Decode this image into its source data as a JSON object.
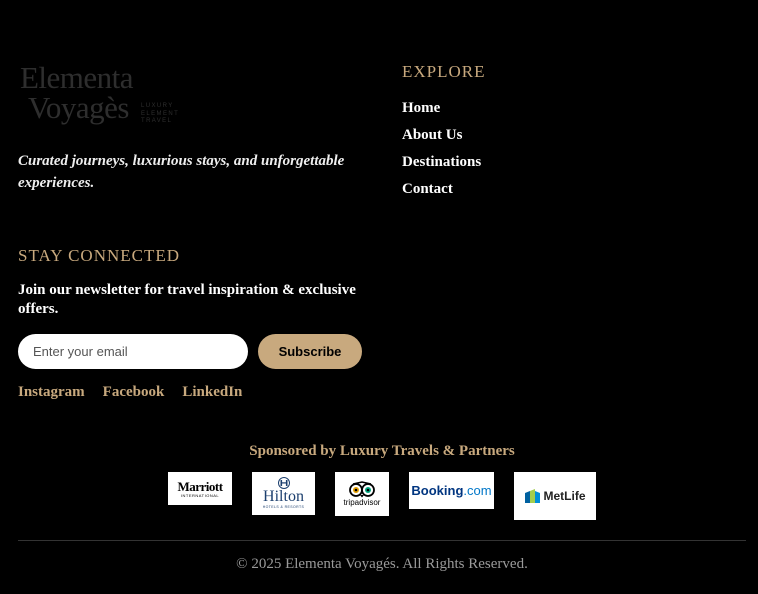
{
  "brand": {
    "logo_line1": "Elementa",
    "logo_line2": "Voyagès",
    "logo_tagline": "LUXURY ELEMENT TRAVEL",
    "tagline": "Curated journeys, luxurious stays, and unforgettable experiences."
  },
  "newsletter": {
    "heading": "STAY CONNECTED",
    "text": "Join our newsletter for travel inspiration & exclusive offers.",
    "email_placeholder": "Enter your email",
    "subscribe_label": "Subscribe"
  },
  "social": [
    "Instagram",
    "Facebook",
    "LinkedIn"
  ],
  "explore": {
    "heading": "EXPLORE",
    "links": [
      "Home",
      "About Us",
      "Destinations",
      "Contact"
    ]
  },
  "sponsors": {
    "title": "Sponsored by Luxury Travels & Partners",
    "items": [
      {
        "name": "marriott",
        "text": "Marriott",
        "sub": "INTERNATIONAL"
      },
      {
        "name": "hilton",
        "text": "Hilton",
        "sub": "HOTELS & RESORTS"
      },
      {
        "name": "tripadvisor",
        "text": "tripadvisor"
      },
      {
        "name": "booking",
        "text_a": "Booking",
        "text_b": ".com"
      },
      {
        "name": "metlife",
        "text": "MetLife"
      }
    ]
  },
  "footer": {
    "copyright": "© 2025 Elementa Voyagés. All Rights Reserved."
  },
  "colors": {
    "background": "#000000",
    "accent": "#c8a97e",
    "booking_blue": "#003580",
    "metlife_blue": "#0061a0",
    "metlife_green": "#a4ce4e"
  }
}
